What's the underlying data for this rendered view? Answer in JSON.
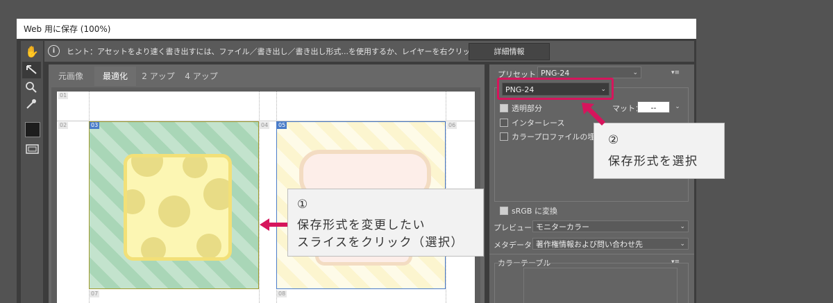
{
  "window": {
    "title": "Web 用に保存 (100%)"
  },
  "hint": {
    "text": "ヒント：アセットをより速く書き出すには、ファイル／書き出し／書き出し形式...を使用するか、レイヤーを右クリックして使用。",
    "detail_button": "詳細情報"
  },
  "tools": [
    "hand-icon",
    "slice-select-icon",
    "zoom-icon",
    "eyedropper-icon",
    "color-swatch",
    "toggle-slices-icon"
  ],
  "tabs": [
    {
      "label": "元画像"
    },
    {
      "label": "最適化"
    },
    {
      "label": "2 アップ"
    },
    {
      "label": "4 アップ"
    }
  ],
  "slices": [
    {
      "label": "01"
    },
    {
      "label": "02"
    },
    {
      "label": "03"
    },
    {
      "label": "04"
    },
    {
      "label": "05"
    },
    {
      "label": "06"
    },
    {
      "label": "07"
    },
    {
      "label": "08"
    }
  ],
  "panel": {
    "preset_label": "プリセット：",
    "preset_value": "PNG-24",
    "format_value": "PNG-24",
    "transparency_label": "透明部分",
    "matte_label": "マット：",
    "matte_value": "--",
    "interlace_label": "インターレース",
    "embed_profile_label": "カラープロファイルの埋め込み",
    "srgb_label": "sRGB に変換",
    "preview_label": "プレビュー：",
    "preview_value": "モニターカラー",
    "metadata_label": "メタデータ：",
    "metadata_value": "著作権情報および問い合わせ先",
    "color_table_label": "カラーテーブル"
  },
  "callout1": {
    "num": "①",
    "line1": "保存形式を変更したい",
    "line2": "スライスをクリック（選択）"
  },
  "callout2": {
    "num": "②",
    "line1": "保存形式を選択"
  },
  "colors": {
    "accent": "#d6155c",
    "slice_selected": "#4a7cc9"
  }
}
